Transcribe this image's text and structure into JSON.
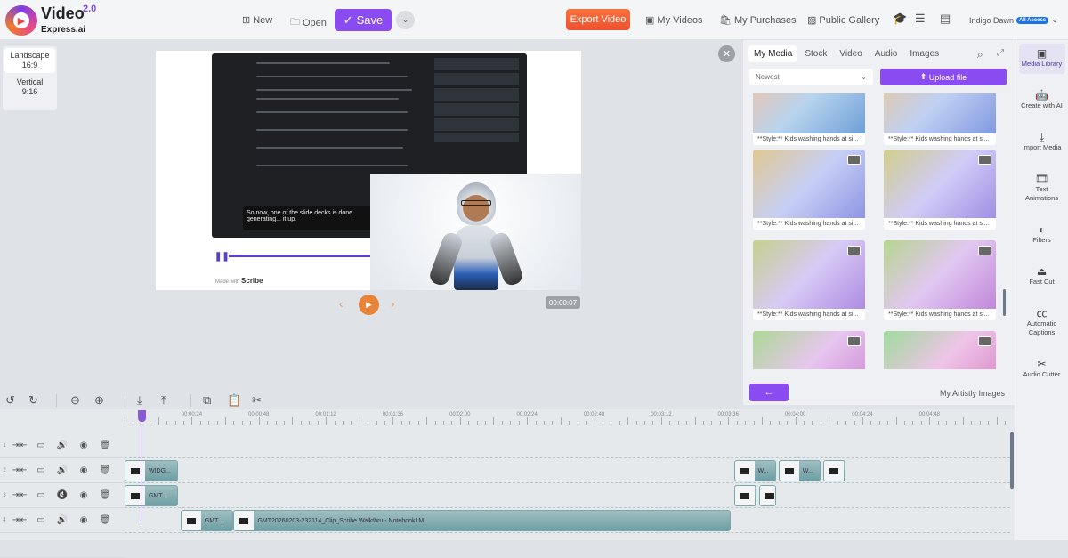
{
  "header": {
    "logo": "Video Express.ai",
    "logo_version": "2.0",
    "new": "New",
    "open": "Open",
    "save": "Save",
    "export": "Export Video",
    "my_videos": "My Videos",
    "my_purchases": "My Purchases",
    "public_gallery": "Public Gallery",
    "user": "Indigo Dawn",
    "user_badge": "All Access"
  },
  "formats": [
    {
      "label": "Landscape",
      "ratio": "16:9",
      "active": true
    },
    {
      "label": "Vertical",
      "ratio": "9:16",
      "active": false
    }
  ],
  "preview": {
    "caption": "So now, one of the slide decks is done generating... it up.",
    "made_with": "Made with",
    "brand": "Scribe",
    "time": "00:00:07"
  },
  "panel": {
    "tabs": [
      "My Media",
      "Stock",
      "Video",
      "Audio",
      "Images"
    ],
    "active_tab": "My Media",
    "sort": "Newest",
    "upload": "Upload file",
    "item_caption": "**Style:** Kids washing hands at si...",
    "footer_link": "My Artistly Images"
  },
  "sidebar": [
    {
      "label": "Media Library",
      "icon": "media-library-icon"
    },
    {
      "label": "Create with AI",
      "icon": "robot-icon"
    },
    {
      "label": "Import Media",
      "icon": "import-icon"
    },
    {
      "label": "Text Animations",
      "icon": "film-icon"
    },
    {
      "label": "Filters",
      "icon": "filter-icon"
    },
    {
      "label": "Fast Cut",
      "icon": "fast-cut-icon"
    },
    {
      "label": "Automatic Captions",
      "icon": "cc-icon"
    },
    {
      "label": "Audio Cutter",
      "icon": "scissors-icon"
    }
  ],
  "timeline": {
    "ruler": [
      "00:00:24",
      "00:00:48",
      "00:01:12",
      "00:01:36",
      "00:02:00",
      "00:02:24",
      "00:02:48",
      "00:03:12",
      "00:03:36",
      "00:04:00",
      "00:04:24",
      "00:04:48"
    ],
    "tracks": [
      {
        "num": "1",
        "muted": false,
        "clips": []
      },
      {
        "num": "2",
        "muted": false,
        "clips": [
          {
            "label": "WIDG...",
            "start": 0,
            "end": 19
          },
          {
            "label": "W...",
            "start": 218,
            "end": 233
          },
          {
            "label": "W...",
            "start": 234,
            "end": 249
          },
          {
            "label": "",
            "start": 250,
            "end": 258
          }
        ]
      },
      {
        "num": "3",
        "muted": true,
        "clips": [
          {
            "label": "GMT...",
            "start": 0,
            "end": 19
          },
          {
            "label": "",
            "start": 218,
            "end": 226
          },
          {
            "label": "",
            "start": 227,
            "end": 233
          }
        ]
      },
      {
        "num": "4",
        "muted": false,
        "clips": [
          {
            "label": "GMT...",
            "start": 20,
            "end": 39
          },
          {
            "label": "GMT20260203-232114_Clip_Scribe Walkthru - NotebookLM",
            "start": 39,
            "end": 217
          }
        ]
      }
    ]
  },
  "colors": {
    "accent": "#8a4cf0",
    "export": "#f4603a",
    "play": "#e8843a"
  }
}
